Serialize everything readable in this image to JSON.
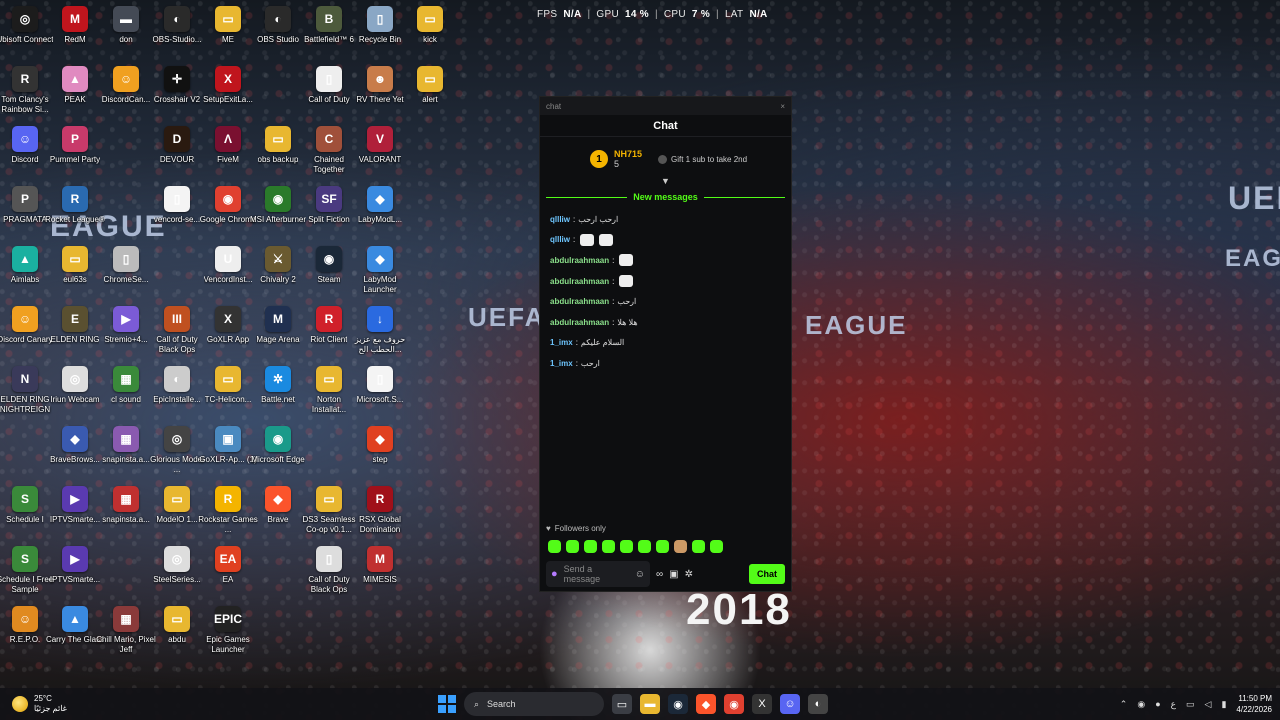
{
  "perf": {
    "fps_label": "FPS",
    "fps_value": "N/A",
    "gpu_label": "GPU",
    "gpu_value": "14 %",
    "cpu_label": "CPU",
    "cpu_value": "7 %",
    "lat_label": "LAT",
    "lat_value": "N/A",
    "sep": "|"
  },
  "background": {
    "banner_left": "EAGUE",
    "banner_center_1": "UEFA",
    "banner_center_2": "EAGUE",
    "banner_right": "UEFA",
    "banner_right_2": "EAGUE",
    "shirt_number": "2018"
  },
  "desktop_icons": [
    {
      "label": "Ubisoft Connect",
      "glyph": "◎",
      "color": "#1c1c1c",
      "name": "ubisoft-connect-icon"
    },
    {
      "label": "RedM",
      "glyph": "M",
      "color": "#c0151d",
      "name": "redm-icon"
    },
    {
      "label": "don",
      "glyph": "▬",
      "color": "#444a55",
      "name": "don-icon"
    },
    {
      "label": "OBS-Studio...",
      "glyph": "◐",
      "color": "#2a2a2a",
      "name": "obs-studio-shortcut-icon"
    },
    {
      "label": "ME",
      "glyph": "▭",
      "color": "#e8b730",
      "name": "me-folder-icon"
    },
    {
      "label": "OBS Studio",
      "glyph": "◐",
      "color": "#2a2a2a",
      "name": "obs-studio-icon"
    },
    {
      "label": "Battlefield™ 6",
      "glyph": "B",
      "color": "#4d5a3c",
      "name": "battlefield-icon"
    },
    {
      "label": "Recycle Bin",
      "glyph": "▯",
      "color": "#8aa7c5",
      "name": "recycle-bin-icon"
    },
    {
      "label": "kick",
      "glyph": "▭",
      "color": "#e8b730",
      "name": "kick-folder-icon"
    },
    {
      "label": "Tom Clancy's Rainbow Si...",
      "glyph": "R",
      "color": "#333",
      "name": "rainbow-six-icon"
    },
    {
      "label": "PEAK",
      "glyph": "▲",
      "color": "#e08ac0",
      "name": "peak-icon"
    },
    {
      "label": "DiscordCan...",
      "glyph": "☺",
      "color": "#f0a020",
      "name": "discord-canary-shortcut-icon"
    },
    {
      "label": "Crosshair V2",
      "glyph": "✛",
      "color": "#111",
      "name": "crosshair-icon"
    },
    {
      "label": "SetupExitLa...",
      "glyph": "X",
      "color": "#c0151d",
      "name": "setup-exit-icon"
    },
    {
      "label": "Call of Duty",
      "glyph": "▯",
      "color": "#eee",
      "name": "call-of-duty-icon"
    },
    {
      "label": "RV There Yet",
      "glyph": "☻",
      "color": "#c87c4a",
      "name": "rv-there-yet-icon"
    },
    {
      "label": "alert",
      "glyph": "▭",
      "color": "#e8b730",
      "name": "alert-folder-icon"
    },
    {
      "label": "Discord",
      "glyph": "☺",
      "color": "#5865f2",
      "name": "discord-icon"
    },
    {
      "label": "Pummel Party",
      "glyph": "P",
      "color": "#c83a6a",
      "name": "pummel-party-icon"
    },
    {
      "label": "DEVOUR",
      "glyph": "D",
      "color": "#2a1a10",
      "name": "devour-icon"
    },
    {
      "label": "FiveM",
      "glyph": "Λ",
      "color": "#7a1030",
      "name": "fivem-icon"
    },
    {
      "label": "obs backup",
      "glyph": "▭",
      "color": "#e8b730",
      "name": "obs-backup-folder-icon"
    },
    {
      "label": "Chained Together",
      "glyph": "C",
      "color": "#a0503a",
      "name": "chained-together-icon"
    },
    {
      "label": "VALORANT",
      "glyph": "V",
      "color": "#b0203a",
      "name": "valorant-icon"
    },
    {
      "label": "PRAGMATA",
      "glyph": "P",
      "color": "#555",
      "name": "pragmata-icon"
    },
    {
      "label": "Rocket League®",
      "glyph": "R",
      "color": "#2a6ab0",
      "name": "rocket-league-icon"
    },
    {
      "label": "vencord-se...",
      "glyph": "▯",
      "color": "#f4f4f4",
      "name": "vencord-setup-icon"
    },
    {
      "label": "Google Chrome",
      "glyph": "◉",
      "color": "#e04030",
      "name": "google-chrome-icon"
    },
    {
      "label": "MSI Afterburner",
      "glyph": "◉",
      "color": "#2a7a2a",
      "name": "msi-afterburner-icon"
    },
    {
      "label": "Split Fiction",
      "glyph": "SF",
      "color": "#4a3a80",
      "name": "split-fiction-icon"
    },
    {
      "label": "LabyModL...",
      "glyph": "◆",
      "color": "#3a8ae0",
      "name": "labymod-launcher-shortcut-icon"
    },
    {
      "label": "Aimlabs",
      "glyph": "▲",
      "color": "#1ab0a0",
      "name": "aimlabs-icon"
    },
    {
      "label": "eul63s",
      "glyph": "▭",
      "color": "#e8b730",
      "name": "eul63s-folder-icon"
    },
    {
      "label": "ChromeSe...",
      "glyph": "▯",
      "color": "#bbb",
      "name": "chrome-setup-icon"
    },
    {
      "label": "VencordInst...",
      "glyph": "U",
      "color": "#eee",
      "name": "vencord-installer-icon"
    },
    {
      "label": "Chivalry 2",
      "glyph": "⚔",
      "color": "#6a5a30",
      "name": "chivalry-icon"
    },
    {
      "label": "Steam",
      "glyph": "◉",
      "color": "#1b2838",
      "name": "steam-icon"
    },
    {
      "label": "LabyMod Launcher",
      "glyph": "◆",
      "color": "#3a8ae0",
      "name": "labymod-launcher-icon"
    },
    {
      "label": "Discord Canary",
      "glyph": "☺",
      "color": "#f0a020",
      "name": "discord-canary-icon"
    },
    {
      "label": "ELDEN RING",
      "glyph": "E",
      "color": "#5a5030",
      "name": "elden-ring-icon"
    },
    {
      "label": "Stremio+4...",
      "glyph": "▶",
      "color": "#7b5bd6",
      "name": "stremio-icon"
    },
    {
      "label": "Call of Duty Black Ops",
      "glyph": "III",
      "color": "#c05020",
      "name": "cod-black-ops-icon"
    },
    {
      "label": "GoXLR App",
      "glyph": "X",
      "color": "#333",
      "name": "goxlr-app-icon"
    },
    {
      "label": "Mage Arena",
      "glyph": "M",
      "color": "#203050",
      "name": "mage-arena-icon"
    },
    {
      "label": "Riot Client",
      "glyph": "R",
      "color": "#d0202a",
      "name": "riot-client-icon"
    },
    {
      "label": "حروف مع عزيز الحطب الح...",
      "glyph": "↓",
      "color": "#2a6ae0",
      "name": "download-shortcut-icon"
    },
    {
      "label": "ELDEN RING NIGHTREIGN",
      "glyph": "N",
      "color": "#3a3a5a",
      "name": "nightreign-icon"
    },
    {
      "label": "Iriun Webcam",
      "glyph": "◎",
      "color": "#ddd",
      "name": "iriun-webcam-icon"
    },
    {
      "label": "cl sound",
      "glyph": "▦",
      "color": "#3a8a3a",
      "name": "cl-sound-icon"
    },
    {
      "label": "EpicInstalle...",
      "glyph": "◐",
      "color": "#ccc",
      "name": "epic-installer-icon"
    },
    {
      "label": "TC-Helicon...",
      "glyph": "▭",
      "color": "#e8b730",
      "name": "tc-helicon-folder-icon"
    },
    {
      "label": "Battle.net",
      "glyph": "✲",
      "color": "#1a8ae0",
      "name": "battle-net-icon"
    },
    {
      "label": "Norton Installat...",
      "glyph": "▭",
      "color": "#e8b730",
      "name": "norton-installer-icon"
    },
    {
      "label": "Microsoft.S...",
      "glyph": "▯",
      "color": "#f4f4f4",
      "name": "microsoft-setup-icon"
    },
    {
      "label": "BraveBrows...",
      "glyph": "◆",
      "color": "#3a5ab0",
      "name": "brave-browser-shortcut-icon"
    },
    {
      "label": "snapinsta.a...",
      "glyph": "▦",
      "color": "#8a5ab0",
      "name": "snapinsta-icon-1"
    },
    {
      "label": "Glorious Model ...",
      "glyph": "◎",
      "color": "#444",
      "name": "glorious-model-icon"
    },
    {
      "label": "GoXLR-Ap... (1)",
      "glyph": "▣",
      "color": "#4a8ac0",
      "name": "goxlr-app-1-icon"
    },
    {
      "label": "Microsoft Edge",
      "glyph": "◉",
      "color": "#1a9a8a",
      "name": "microsoft-edge-icon"
    },
    {
      "label": "step",
      "glyph": "◆",
      "color": "#e04020",
      "name": "step-icon"
    },
    {
      "label": "Schedule I",
      "glyph": "S",
      "color": "#3a8a3a",
      "name": "schedule-one-icon"
    },
    {
      "label": "IPTVSmarte...",
      "glyph": "▶",
      "color": "#5a3ab0",
      "name": "iptv-smarters-shortcut-icon"
    },
    {
      "label": "snapinsta.a...",
      "glyph": "▦",
      "color": "#c03030",
      "name": "snapinsta-icon-2"
    },
    {
      "label": "ModelO 1...",
      "glyph": "▭",
      "color": "#e8b730",
      "name": "modelo-folder-icon"
    },
    {
      "label": "Rockstar Games ...",
      "glyph": "R",
      "color": "#f4b400",
      "name": "rockstar-games-icon"
    },
    {
      "label": "Brave",
      "glyph": "◆",
      "color": "#fb542b",
      "name": "brave-icon"
    },
    {
      "label": "DS3 Seamless Co-op v0.1...",
      "glyph": "▭",
      "color": "#e8b730",
      "name": "ds3-seamless-coop-icon"
    },
    {
      "label": "RSX Global Domination",
      "glyph": "R",
      "color": "#a0101a",
      "name": "rsx-global-domination-icon"
    },
    {
      "label": "Schedule I Free Sample",
      "glyph": "S",
      "color": "#3a8a3a",
      "name": "schedule-one-free-icon"
    },
    {
      "label": "IPTVSmarte...",
      "glyph": "▶",
      "color": "#5a3ab0",
      "name": "iptv-smarters-icon"
    },
    {
      "label": "SteelSeries...",
      "glyph": "◎",
      "color": "#ddd",
      "name": "steelseries-icon"
    },
    {
      "label": "EA",
      "glyph": "EA",
      "color": "#e04020",
      "name": "ea-icon"
    },
    {
      "label": "Call of Duty Black Ops",
      "glyph": "▯",
      "color": "#ddd",
      "name": "cod-black-ops-2-icon"
    },
    {
      "label": "MIMESIS",
      "glyph": "M",
      "color": "#c03030",
      "name": "mimesis-icon"
    },
    {
      "label": "R.E.P.O.",
      "glyph": "☺",
      "color": "#e08a20",
      "name": "repo-icon"
    },
    {
      "label": "Carry The Glass",
      "glyph": "▲",
      "color": "#3a8ae0",
      "name": "carry-the-glass-icon"
    },
    {
      "label": "Chill Mario, Pixel Jeff",
      "glyph": "▦",
      "color": "#8a3a3a",
      "name": "chill-mario-icon"
    },
    {
      "label": "abdu",
      "glyph": "▭",
      "color": "#e8b730",
      "name": "abdu-folder-icon"
    },
    {
      "label": "Epic Games Launcher",
      "glyph": "EPIC",
      "color": "#222",
      "name": "epic-games-launcher-icon"
    }
  ],
  "chat": {
    "window_title": "chat",
    "close_glyph": "×",
    "header": "Chat",
    "pinned": {
      "rank": "1",
      "username": "NH715",
      "count": "5",
      "gift_text": "Gift 1 sub to take 2nd"
    },
    "collapse_glyph": "▼",
    "new_messages_label": "New messages",
    "messages": [
      {
        "user": "qllliw",
        "text": "ارحب ارحب",
        "color": "#6ec6ff",
        "emotes": 0
      },
      {
        "user": "qllliw",
        "text": "",
        "color": "#6ec6ff",
        "emotes": 2
      },
      {
        "user": "abdulraahmaan",
        "text": "",
        "color": "#8be08b",
        "emotes": 1
      },
      {
        "user": "abdulraahmaan",
        "text": "",
        "color": "#8be08b",
        "emotes": 1
      },
      {
        "user": "abdulraahmaan",
        "text": "ارحب",
        "color": "#8be08b",
        "emotes": 0
      },
      {
        "user": "abdulraahmaan",
        "text": "هلا هلا",
        "color": "#8be08b",
        "emotes": 0
      },
      {
        "user": "1_imx",
        "text": "السلام عليكم",
        "color": "#6ec6ff",
        "emotes": 0
      },
      {
        "user": "1_imx",
        "text": "ارحب",
        "color": "#6ec6ff",
        "emotes": 0
      }
    ],
    "followers_only": "Followers only",
    "input_placeholder": "Send a message",
    "send_label": "Chat",
    "accent": "#53fc18"
  },
  "taskbar": {
    "temperature": "25°C",
    "weather_text": "غائم جزئيًا",
    "search_label": "Search",
    "time": "11:50 PM",
    "date": "4/22/2026",
    "language": "ع"
  }
}
